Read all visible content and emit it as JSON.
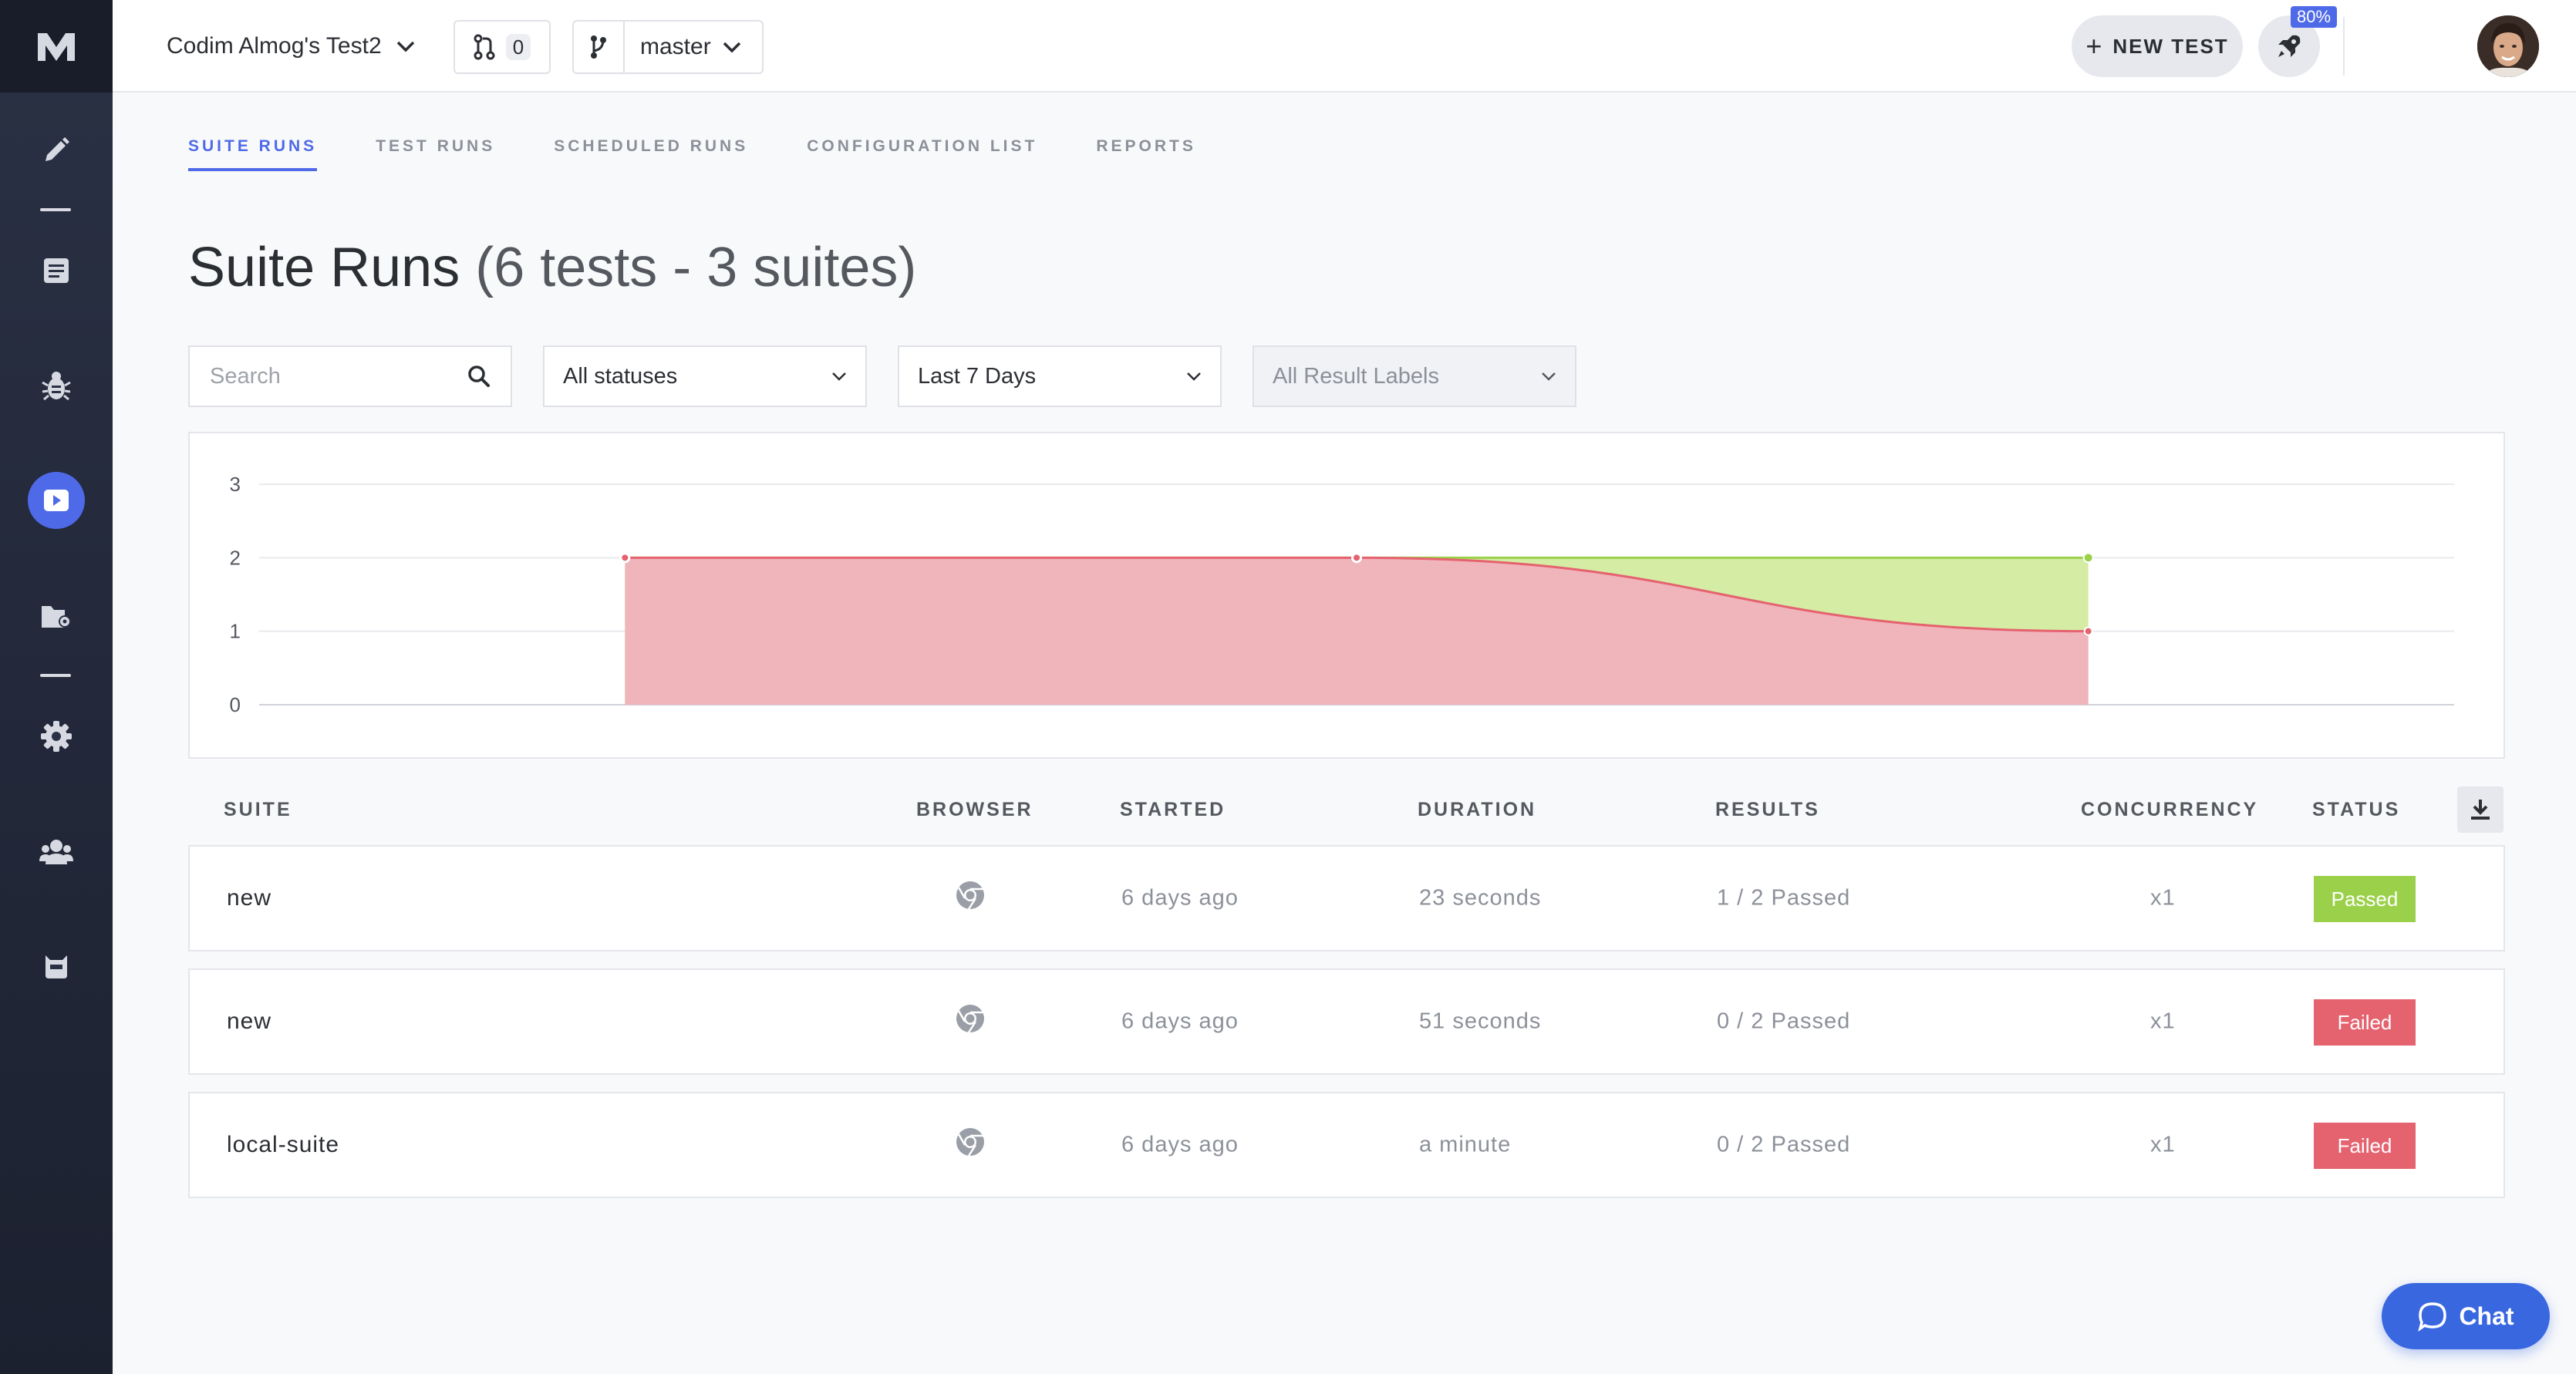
{
  "colors": {
    "accent": "#4f6ae8",
    "passed": "#9bd14a",
    "failed": "#e5626f",
    "passed_fill": "#d5eca4",
    "failed_fill": "#f0b4bb"
  },
  "sidebar": {
    "logo": "M",
    "items": [
      {
        "icon": "pencil-icon"
      },
      {
        "icon": "document-icon"
      },
      {
        "icon": "bug-icon"
      },
      {
        "icon": "play-icon",
        "active": true
      },
      {
        "icon": "folder-settings-icon"
      },
      {
        "icon": "gear-icon"
      },
      {
        "icon": "users-icon"
      },
      {
        "icon": "robot-icon"
      }
    ]
  },
  "header": {
    "project_name": "Codim Almog's Test2",
    "pr_count": "0",
    "branch": "master",
    "new_test_label": "NEW TEST",
    "notification_badge": "80%"
  },
  "tabs": [
    {
      "label": "SUITE RUNS",
      "active": true
    },
    {
      "label": "TEST RUNS"
    },
    {
      "label": "SCHEDULED RUNS"
    },
    {
      "label": "CONFIGURATION LIST"
    },
    {
      "label": "REPORTS"
    }
  ],
  "page": {
    "title": "Suite Runs",
    "subtitle": "(6 tests - 3 suites)"
  },
  "filters": {
    "search_placeholder": "Search",
    "status": "All statuses",
    "date_range": "Last 7 Days",
    "result_labels": "All Result Labels"
  },
  "chart_data": {
    "type": "area",
    "x": [
      1,
      2,
      3
    ],
    "xlim": [
      0.5,
      3.5
    ],
    "ylim": [
      0,
      3
    ],
    "yticks": [
      "0",
      "1",
      "2",
      "3"
    ],
    "grid": true,
    "series": [
      {
        "values": [
          2,
          2,
          2
        ],
        "color": "#9bd14a"
      },
      {
        "values": [
          2,
          2,
          1
        ],
        "color": "#e5626f"
      }
    ]
  },
  "table": {
    "columns": [
      "SUITE",
      "BROWSER",
      "STARTED",
      "DURATION",
      "RESULTS",
      "CONCURRENCY",
      "STATUS"
    ],
    "rows": [
      {
        "suite": "new",
        "browser": "chrome-icon",
        "started": "6 days ago",
        "duration": "23 seconds",
        "results": "1 / 2 Passed",
        "concurrency": "x1",
        "status": "Passed"
      },
      {
        "suite": "new",
        "browser": "chrome-icon",
        "started": "6 days ago",
        "duration": "51 seconds",
        "results": "0 / 2 Passed",
        "concurrency": "x1",
        "status": "Failed"
      },
      {
        "suite": "local-suite",
        "browser": "chrome-icon",
        "started": "6 days ago",
        "duration": "a minute",
        "results": "0 / 2 Passed",
        "concurrency": "x1",
        "status": "Failed"
      }
    ]
  },
  "chat": {
    "label": "Chat"
  }
}
